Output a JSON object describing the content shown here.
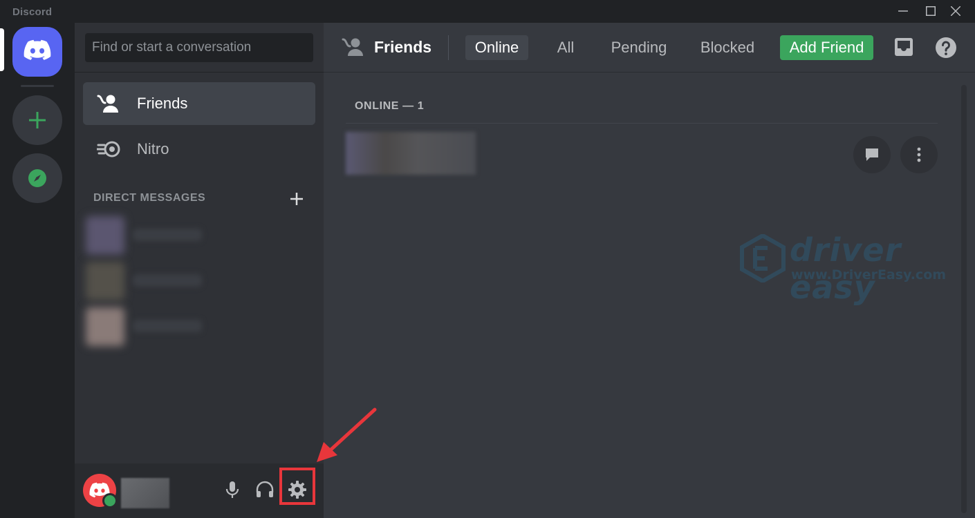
{
  "window": {
    "title": "Discord"
  },
  "sidebar": {
    "search_placeholder": "Find or start a conversation",
    "nav": [
      {
        "label": "Friends",
        "active": true
      },
      {
        "label": "Nitro",
        "active": false
      }
    ],
    "dm_header": "DIRECT MESSAGES"
  },
  "main": {
    "header_title": "Friends",
    "tabs": [
      {
        "label": "Online",
        "active": true
      },
      {
        "label": "All",
        "active": false
      },
      {
        "label": "Pending",
        "active": false
      },
      {
        "label": "Blocked",
        "active": false
      }
    ],
    "add_friend": "Add Friend",
    "section_label": "ONLINE — 1"
  },
  "watermark": {
    "brand": "driver easy",
    "url": "www.DriverEasy.com"
  },
  "colors": {
    "blurple": "#5865f2",
    "green": "#3ba55d",
    "red_avatar": "#ed4245",
    "highlight": "#e8363b"
  },
  "icons": [
    "discord-logo-icon",
    "plus-icon",
    "compass-icon",
    "friends-icon",
    "nitro-icon",
    "microphone-icon",
    "headphones-icon",
    "gear-icon",
    "inbox-icon",
    "help-icon",
    "message-icon",
    "more-vertical-icon"
  ]
}
